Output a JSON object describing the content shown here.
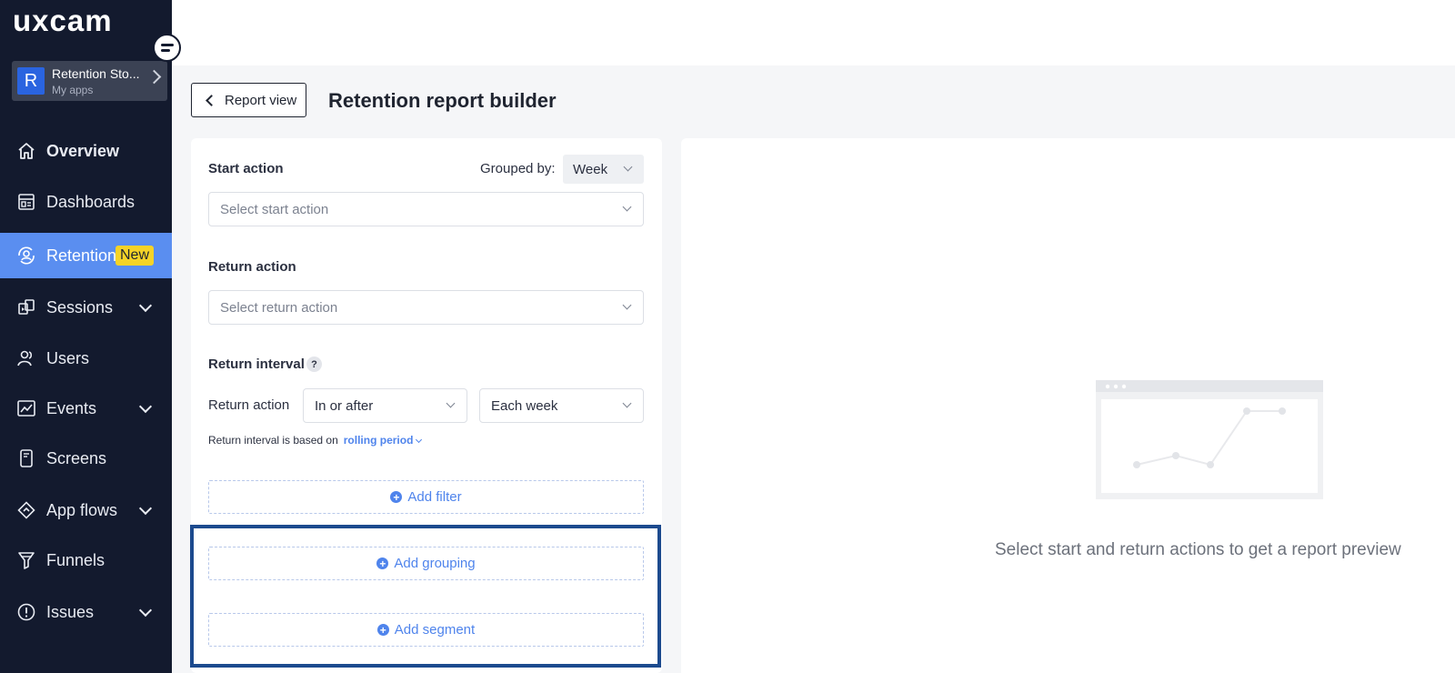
{
  "brand": {
    "logo_text": "uxcam"
  },
  "app_switcher": {
    "avatar_letter": "R",
    "name": "Retention Sto...",
    "subtitle": "My apps"
  },
  "nav": {
    "items": [
      {
        "label": "Overview",
        "icon": "home-icon",
        "active": false,
        "expandable": false
      },
      {
        "label": "Dashboards",
        "icon": "dashboard-icon",
        "active": false,
        "expandable": false
      },
      {
        "label": "Retention",
        "icon": "retention-icon",
        "active": true,
        "expandable": false,
        "badge": "New"
      },
      {
        "label": "Sessions",
        "icon": "sessions-icon",
        "active": false,
        "expandable": true
      },
      {
        "label": "Users",
        "icon": "users-icon",
        "active": false,
        "expandable": false
      },
      {
        "label": "Events",
        "icon": "events-icon",
        "active": false,
        "expandable": true
      },
      {
        "label": "Screens",
        "icon": "screens-icon",
        "active": false,
        "expandable": false
      },
      {
        "label": "App flows",
        "icon": "app-flows-icon",
        "active": false,
        "expandable": true
      },
      {
        "label": "Funnels",
        "icon": "funnel-icon",
        "active": false,
        "expandable": false
      },
      {
        "label": "Issues",
        "icon": "issues-icon",
        "active": false,
        "expandable": true
      }
    ]
  },
  "header": {
    "back_label": "Report view",
    "title": "Retention report builder"
  },
  "builder": {
    "start_action": {
      "label": "Start action",
      "placeholder": "Select start action"
    },
    "grouped_by": {
      "label": "Grouped by:",
      "value": "Week"
    },
    "return_action": {
      "label": "Return action",
      "placeholder": "Select return action"
    },
    "return_interval": {
      "label": "Return interval",
      "help": "?",
      "row_label": "Return action",
      "condition_value": "In or after",
      "period_value": "Each week",
      "note_text": "Return interval is based on",
      "note_link": "rolling period"
    },
    "add_filter": "Add filter",
    "add_grouping": "Add grouping",
    "add_segment": "Add segment"
  },
  "preview": {
    "empty_message": "Select start and return actions to get a report preview"
  },
  "colors": {
    "sidebar_bg": "#131a2e",
    "active_nav": "#5a8ef0",
    "badge": "#f5d327",
    "accent": "#4f84ec",
    "highlight_border": "#1c4a8e"
  }
}
